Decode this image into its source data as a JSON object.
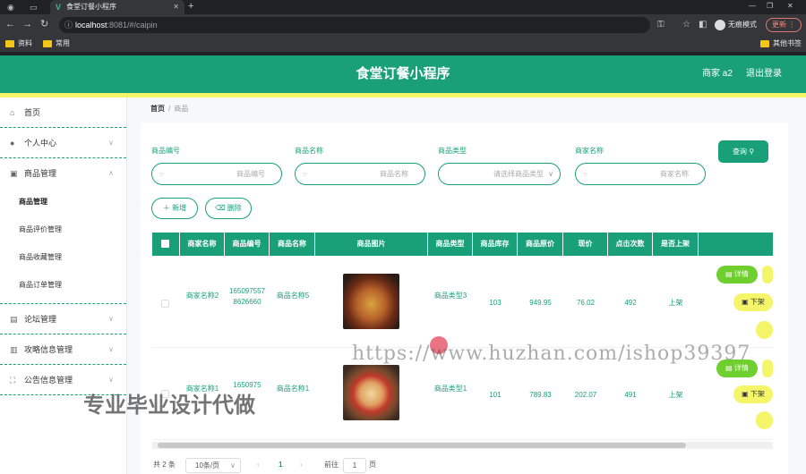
{
  "browser": {
    "tab_title": "食堂订餐小程序",
    "url_host": "localhost",
    "url_path": ":8081/#/caipin",
    "incognito_label": "无痕模式",
    "update_label": "更新",
    "bookmarks": [
      "资料",
      "常用"
    ],
    "other_bookmarks": "其他书签"
  },
  "header": {
    "title": "食堂订餐小程序",
    "user": "商家 a2",
    "logout": "退出登录"
  },
  "sidebar": {
    "items": [
      {
        "label": "首页",
        "icon": "home-icon"
      },
      {
        "label": "个人中心",
        "icon": "user-icon"
      },
      {
        "label": "商品管理",
        "icon": "briefcase-icon"
      },
      {
        "label": "论坛管理",
        "icon": "forum-icon"
      },
      {
        "label": "攻略信息管理",
        "icon": "clipboard-icon"
      },
      {
        "label": "公告信息管理",
        "icon": "notice-icon"
      }
    ],
    "sub_items": [
      "商品管理",
      "商品评价管理",
      "商品收藏管理",
      "商品订单管理"
    ]
  },
  "breadcrumb": {
    "home": "首页",
    "current": "商品"
  },
  "filters": [
    {
      "label": "商品编号",
      "placeholder": "商品编号"
    },
    {
      "label": "商品名称",
      "placeholder": "商品名称"
    },
    {
      "label": "商品类型",
      "placeholder": "请选择商品类型"
    },
    {
      "label": "商家名称",
      "placeholder": "商家名称"
    }
  ],
  "buttons": {
    "search": "查询",
    "add": "新增",
    "delete": "删除"
  },
  "table": {
    "columns": [
      "商家名称",
      "商品编号",
      "商品名称",
      "商品图片",
      "商品类型",
      "商品库存",
      "商品原价",
      "现价",
      "点击次数",
      "是否上架"
    ],
    "rows": [
      {
        "merchant": "商家名称2",
        "code": "1650975578626660",
        "name": "商品名称5",
        "type": "商品类型3",
        "stock": "103",
        "original_price": "949.95",
        "price": "76.02",
        "clicks": "492",
        "status": "上架"
      },
      {
        "merchant": "商家名称1",
        "code": "1650975",
        "name": "商品名称1",
        "type": "商品类型1",
        "stock": "101",
        "original_price": "789.83",
        "price": "202.07",
        "clicks": "491",
        "status": "上架"
      }
    ],
    "actions": {
      "detail": "详情",
      "unlist": "下架"
    }
  },
  "pagination": {
    "total": "共 2 条",
    "page_size": "10条/页",
    "current_page": "1",
    "goto_label": "前往",
    "goto_value": "1",
    "page_unit": "页"
  },
  "watermarks": {
    "url": "https://www.huzhan.com/ishop39397",
    "text": "专业毕业设计代做"
  },
  "colors": {
    "primary": "#1aa078",
    "accent_yellow": "#f5f56a",
    "action_green": "#6fcf2e"
  }
}
